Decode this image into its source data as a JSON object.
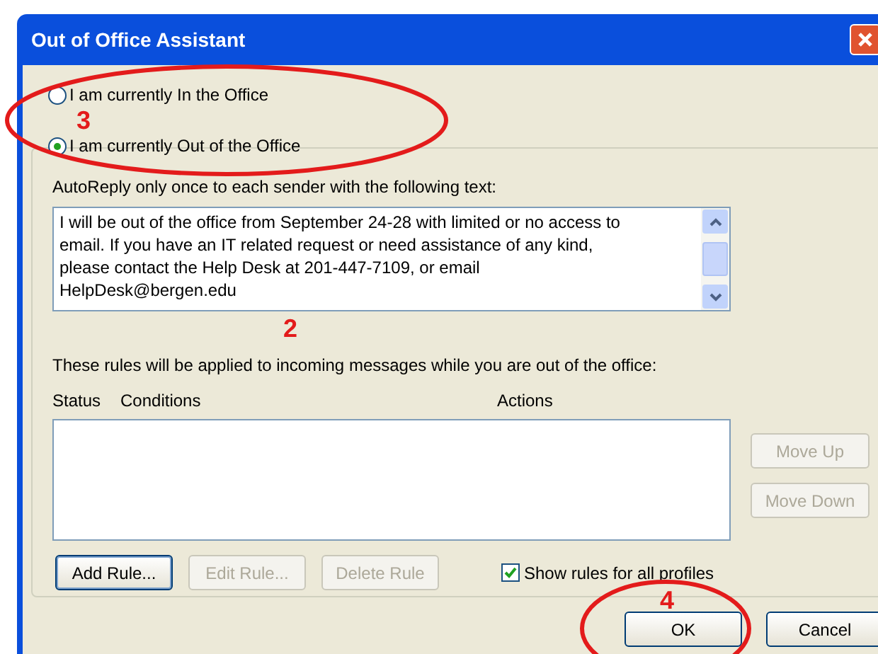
{
  "window": {
    "title": "Out of Office Assistant"
  },
  "status_options": [
    {
      "label": "I am currently In the Office",
      "selected": false
    },
    {
      "label": "I am currently Out of the Office",
      "selected": true
    }
  ],
  "autoreply": {
    "label": "AutoReply only once to each sender with the following text:",
    "value": "I will be out of the office from September 24-28 with limited or no access to email.  If you have an IT related request or need assistance of any kind, please contact the Help Desk at 201-447-7109, or email HelpDesk@bergen.edu"
  },
  "rules": {
    "caption": "These rules will be applied to incoming messages while you are out of the office:",
    "columns": [
      "Status",
      "Conditions",
      "Actions"
    ]
  },
  "side_buttons": [
    {
      "label": "Move Up",
      "disabled": true
    },
    {
      "label": "Move Down",
      "disabled": true
    }
  ],
  "rule_buttons": [
    {
      "label": "Add Rule...",
      "disabled": false
    },
    {
      "label": "Edit Rule...",
      "disabled": true
    },
    {
      "label": "Delete Rule",
      "disabled": true
    }
  ],
  "show_all_profiles": {
    "label": "Show rules for all profiles",
    "checked": true
  },
  "dialog_buttons": [
    "OK",
    "Cancel"
  ],
  "annotations": [
    "3",
    "2",
    "4"
  ]
}
